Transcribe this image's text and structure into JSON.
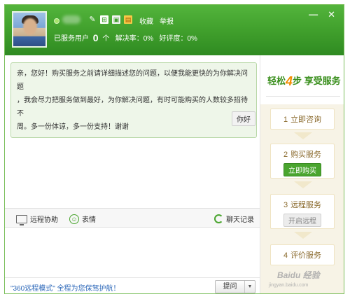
{
  "header": {
    "links": [
      "收藏",
      "举报"
    ],
    "stats": {
      "served_label": "已服务用户",
      "served_value": "0",
      "served_unit": "个",
      "resolve_label": "解决率：0%",
      "rating_label": "好评度：0%"
    },
    "window_buttons": {
      "minimize": "—",
      "close": "✕"
    }
  },
  "chat": {
    "messages": [
      {
        "side": "left",
        "lines": [
          "亲，您好！购买服务之前请详细描述您的问题，以便我能更快的为你解决问题",
          "，我会尽力把服务做到最好，为你解决问题，有时可能购买的人数较多招待不",
          "周。多一份体谅，多一份支持！谢谢"
        ]
      },
      {
        "side": "right",
        "text": "你好"
      }
    ]
  },
  "toolbar": {
    "remote": "远程协助",
    "emoji": "表情",
    "history": "聊天记录"
  },
  "bottom": {
    "promo": "\"360远程模式\" 全程为您保驾护航！",
    "send_label": "提问",
    "send_arrow": "▼"
  },
  "panel": {
    "title_prefix": "轻松",
    "title_number": "4",
    "title_suffix": "步 享受服务",
    "steps": [
      {
        "num": "1",
        "label": "立即咨询"
      },
      {
        "num": "2",
        "label": "购买服务",
        "button": "立即购买"
      },
      {
        "num": "3",
        "label": "远程服务",
        "button": "开启远程"
      },
      {
        "num": "4",
        "label": "评价服务"
      }
    ]
  },
  "watermark": {
    "brand": "Baidu 经验",
    "url": "jingyan.baidu.com"
  },
  "colors": {
    "header_green": "#3f9e2b",
    "accent_orange": "#f28c00",
    "step_brown": "#8a6a2d",
    "link_blue": "#2a66b8"
  }
}
